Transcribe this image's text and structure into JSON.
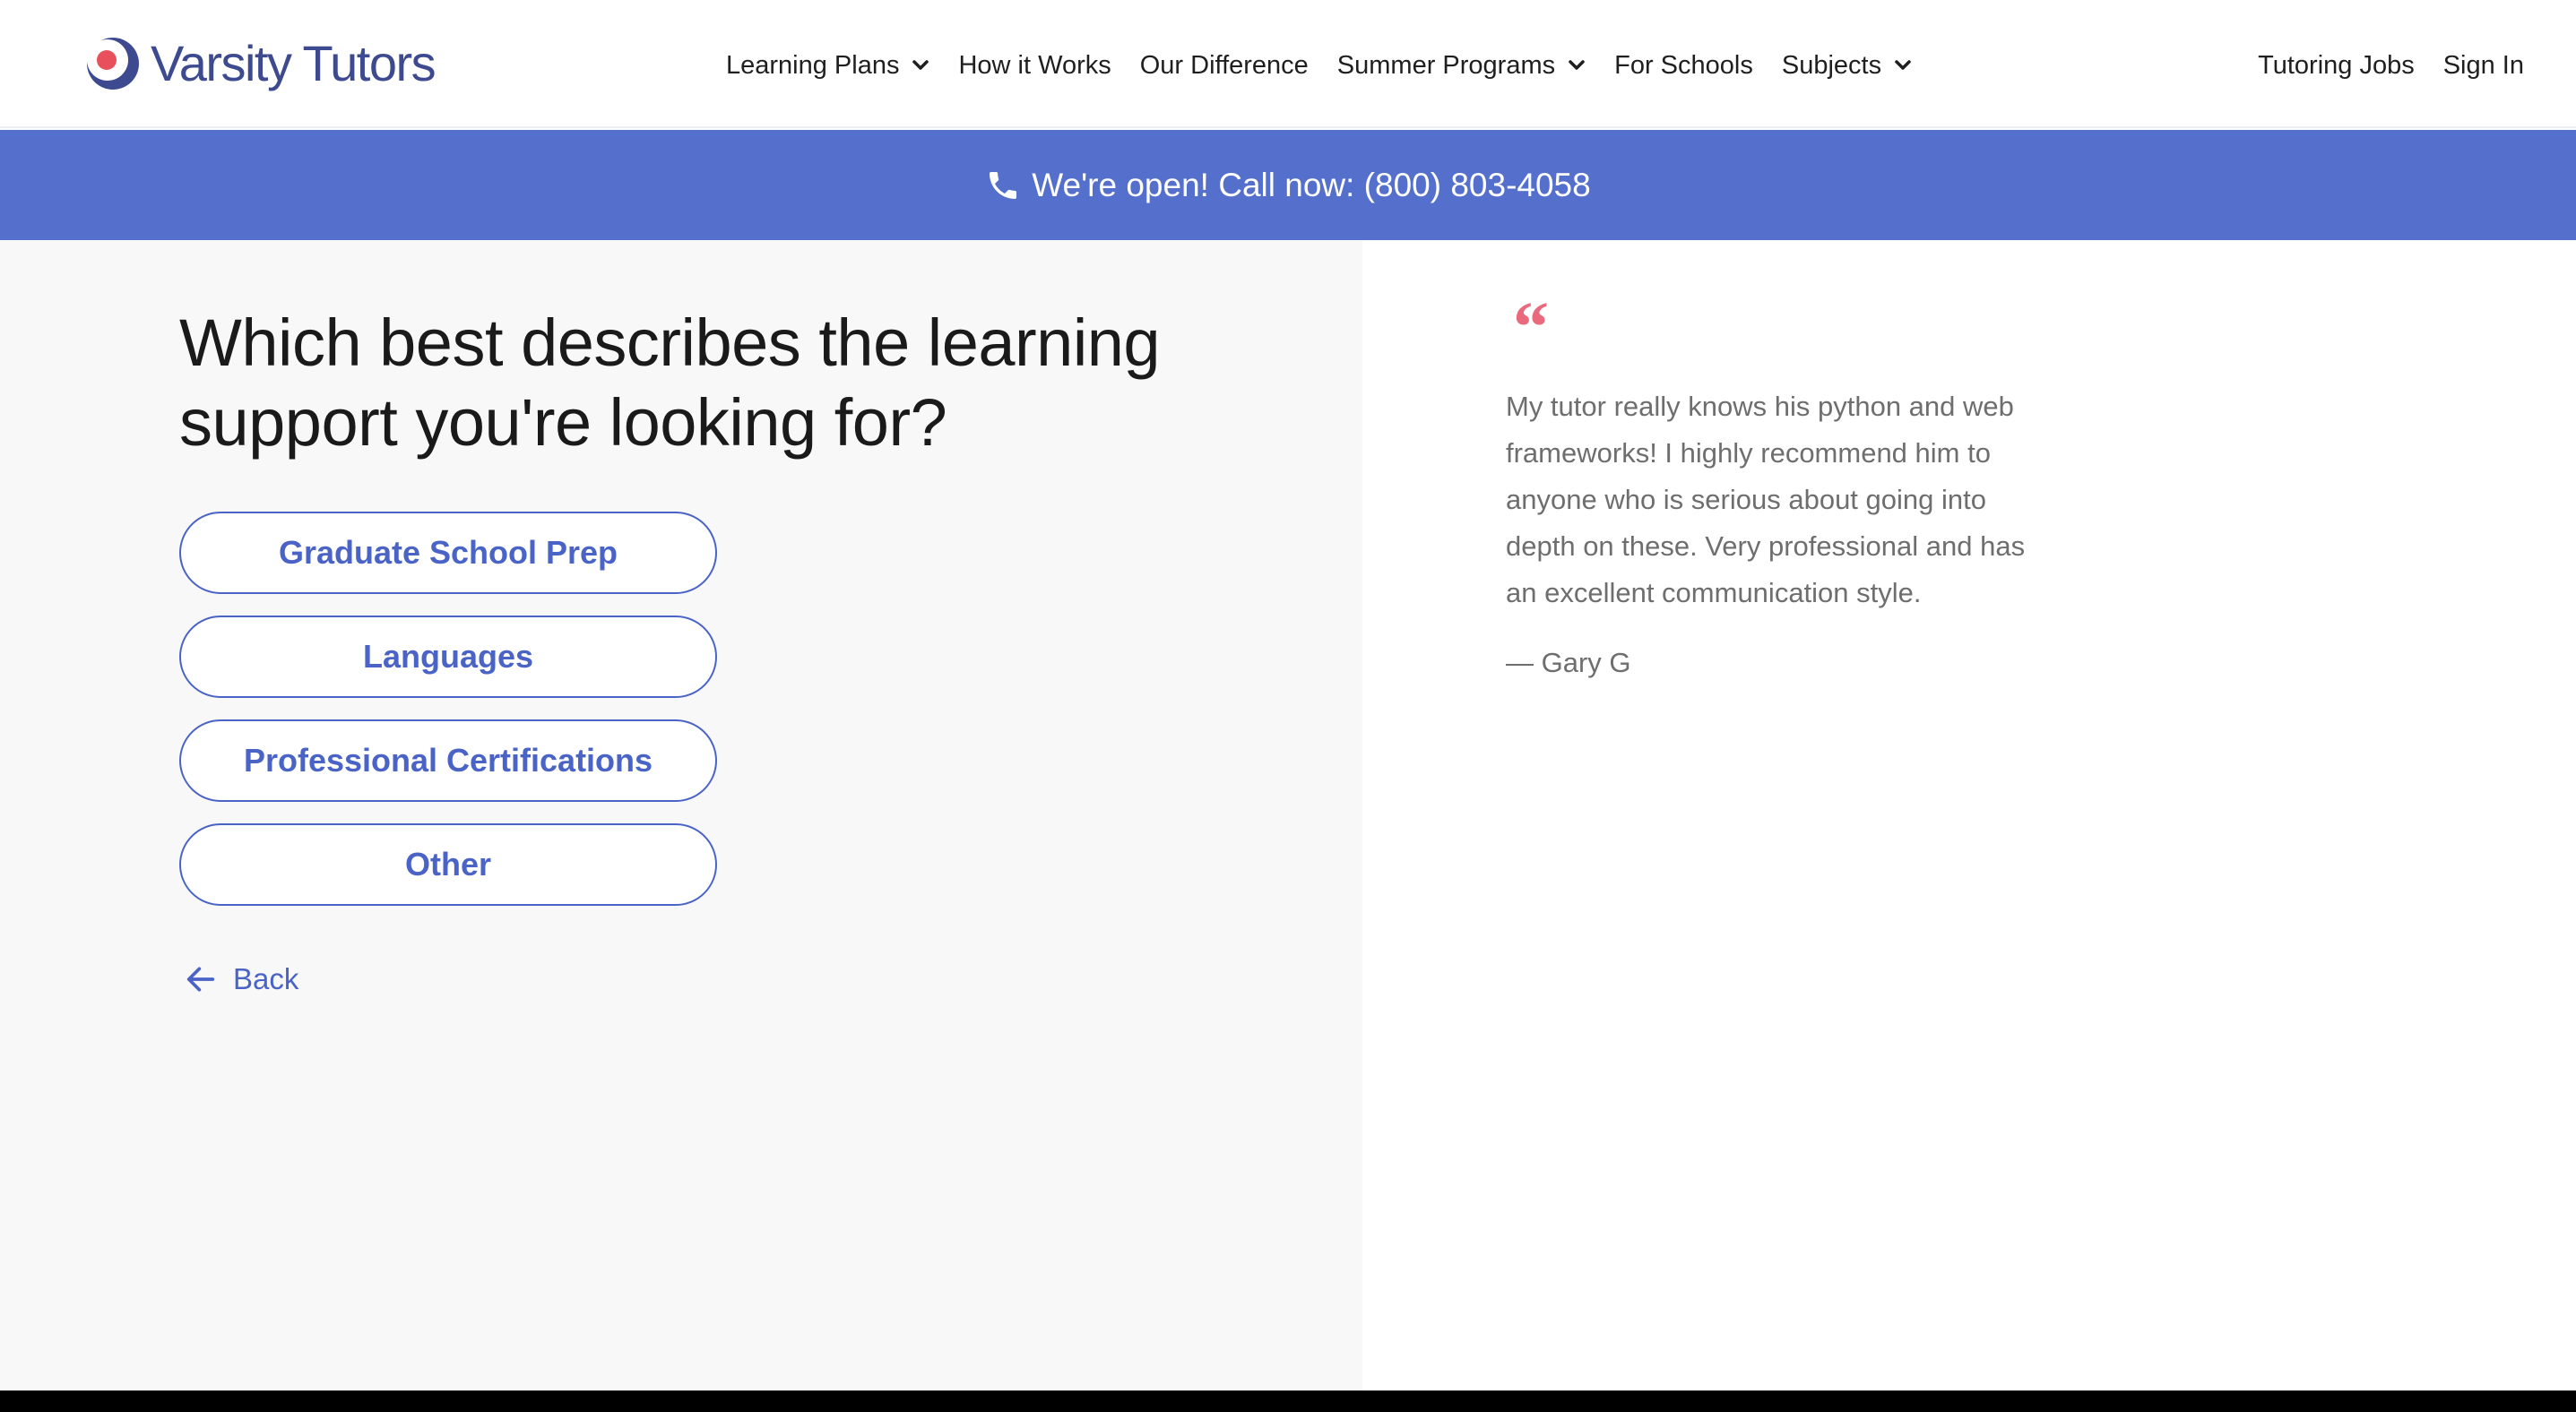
{
  "header": {
    "logo_text": "Varsity Tutors",
    "nav": [
      {
        "label": "Learning Plans",
        "has_dropdown": true
      },
      {
        "label": "How it Works",
        "has_dropdown": false
      },
      {
        "label": "Our Difference",
        "has_dropdown": false
      },
      {
        "label": "Summer Programs",
        "has_dropdown": true
      },
      {
        "label": "For Schools",
        "has_dropdown": false
      },
      {
        "label": "Subjects",
        "has_dropdown": true
      }
    ],
    "right_links": [
      {
        "label": "Tutoring Jobs"
      },
      {
        "label": "Sign In"
      }
    ]
  },
  "banner": {
    "icon": "phone-icon",
    "text": "We're open! Call now: (800) 803-4058"
  },
  "question": {
    "title": "Which best describes the learning support you're looking for?",
    "options": [
      {
        "label": "Graduate School Prep"
      },
      {
        "label": "Languages"
      },
      {
        "label": "Professional Certifications"
      },
      {
        "label": "Other"
      }
    ],
    "back_label": "Back",
    "back_icon": "arrow-left-icon"
  },
  "testimonial": {
    "quote_glyph": "“",
    "text": "My tutor really knows his python and web frameworks! I highly recommend him to anyone who is serious about going into depth on these. Very professional and has an excellent communication style.",
    "author": "— Gary G"
  },
  "colors": {
    "brand_blue": "#4a63c6",
    "banner_blue": "#5470cc",
    "logo_navy": "#3d4a8f",
    "logo_red": "#e8505b",
    "quote_pink": "#e86a7c",
    "panel_gray": "#f8f8f8",
    "text_dark": "#1a1a1a",
    "text_muted": "#6e6e6e"
  }
}
